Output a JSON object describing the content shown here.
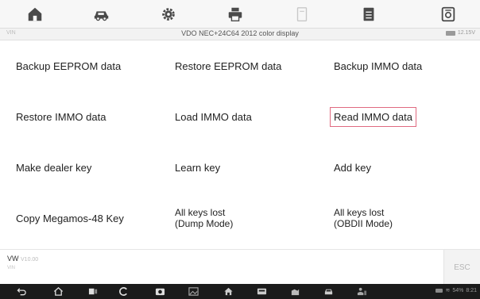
{
  "toolbar": {
    "icons": [
      "home-icon",
      "car-icon",
      "gear-icon",
      "print-icon",
      "help-icon",
      "notepad-icon",
      "data-logging-icon"
    ]
  },
  "titlebar": {
    "left": "VIN",
    "title": "VDO NEC+24C64 2012 color display",
    "battery": "12.15V"
  },
  "functions": {
    "backup_eeprom": "Backup EEPROM data",
    "restore_eeprom": "Restore EEPROM data",
    "backup_immo": "Backup IMMO data",
    "restore_immo": "Restore IMMO data",
    "load_immo": "Load IMMO data",
    "read_immo": "Read IMMO data",
    "make_dealer_key": "Make dealer key",
    "learn_key": "Learn key",
    "add_key": "Add key",
    "copy_megamos": "Copy Megamos-48 Key",
    "all_keys_lost_dump_1": "All keys lost",
    "all_keys_lost_dump_2": "(Dump Mode)",
    "all_keys_lost_obd_1": "All keys lost",
    "all_keys_lost_obd_2": "(OBDII Mode)"
  },
  "selected": "read_immo",
  "info": {
    "make": "VW",
    "make_sub": "V10.00",
    "version": "VIN"
  },
  "esc_label": "ESC",
  "status": {
    "battery": "54%",
    "time": "8:21"
  }
}
